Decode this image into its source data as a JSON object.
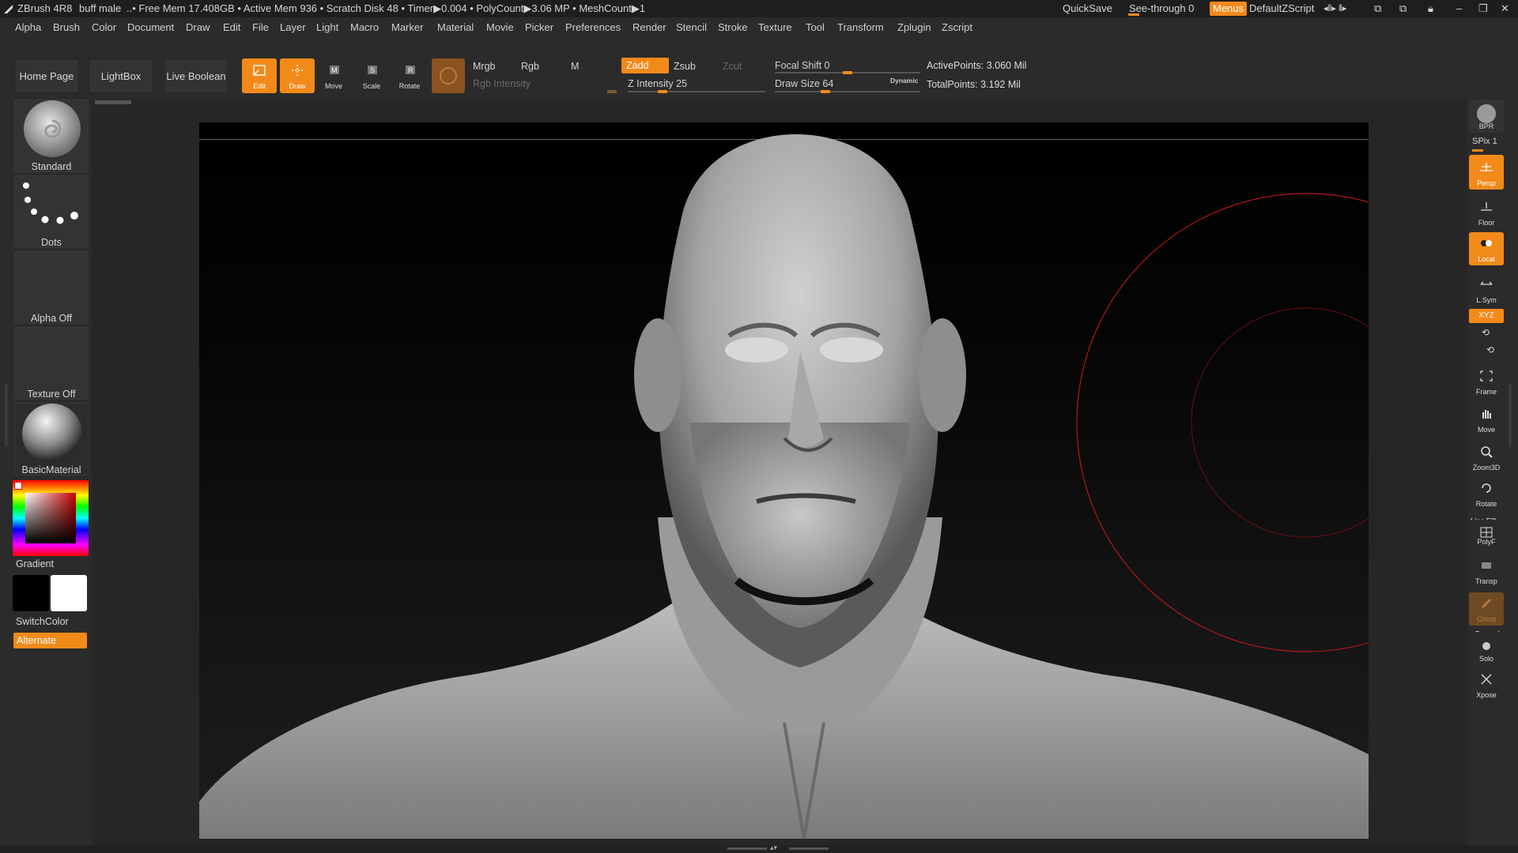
{
  "titlebar": {
    "app": "ZBrush 4R8",
    "doc": "buff male",
    "stats": "..• Free Mem 17.408GB • Active Mem 936 • Scratch Disk 48 •  Timer▶0.004 • PolyCount▶3.06 MP  • MeshCount▶1",
    "quicksave": "QuickSave",
    "seethrough": "See-through  0",
    "menus": "Menus",
    "script": "DefaultZScript"
  },
  "menu": [
    "Alpha",
    "Brush",
    "Color",
    "Document",
    "Draw",
    "Edit",
    "File",
    "Layer",
    "Light",
    "Macro",
    "Marker",
    "Material",
    "Movie",
    "Picker",
    "Preferences",
    "Render",
    "Stencil",
    "Stroke",
    "Texture",
    "Tool",
    "Transform",
    "Zplugin",
    "Zscript"
  ],
  "toolbar": {
    "home": "Home Page",
    "lightbox": "LightBox",
    "liveboolean": "Live Boolean",
    "tools": [
      {
        "label": "Edit",
        "active": true
      },
      {
        "label": "Draw",
        "active": true
      },
      {
        "label": "Move",
        "active": false
      },
      {
        "label": "Scale",
        "active": false
      },
      {
        "label": "Rotate",
        "active": false
      }
    ],
    "mrgb": "Mrgb",
    "rgb": "Rgb",
    "m": "M",
    "rgb_intensity": "Rgb Intensity",
    "zadd": "Zadd",
    "zsub": "Zsub",
    "zcut": "Zcut",
    "z_intensity": "Z Intensity 25",
    "focal_shift": "Focal Shift 0",
    "draw_size": "Draw Size 64",
    "dynamic": "Dynamic",
    "active_points": "ActivePoints: 3.060 Mil",
    "total_points": "TotalPoints: 3.192 Mil",
    "z_intensity_value": 25,
    "focal_shift_value": 0,
    "draw_size_value": 64
  },
  "leftshelf": {
    "brush": "Standard",
    "stroke": "Dots",
    "alpha": "Alpha Off",
    "texture": "Texture Off",
    "material": "BasicMaterial",
    "gradient": "Gradient",
    "switchcolor": "SwitchColor",
    "alternate": "Alternate"
  },
  "rightshelf": {
    "bpr": "BPR",
    "spix": "SPix 1",
    "buttons": [
      {
        "label": "Persp",
        "active": true
      },
      {
        "label": "Floor",
        "active": false
      },
      {
        "label": "Local",
        "active": true
      },
      {
        "label": "L.Sym",
        "active": false
      },
      {
        "label": "Frame",
        "active": false
      },
      {
        "label": "Move",
        "active": false
      },
      {
        "label": "Zoom3D",
        "active": false
      },
      {
        "label": "Rotate",
        "active": false
      },
      {
        "label": "PolyF",
        "active": false
      },
      {
        "label": "Transp",
        "active": false
      },
      {
        "label": "Ghost",
        "active": false
      },
      {
        "label": "Solo",
        "active": false
      },
      {
        "label": "Xpose",
        "active": false
      }
    ],
    "xyz": "XYZ",
    "linefill": "Line Fill",
    "dynamic": "Dynamic"
  },
  "colors": {
    "accent": "#f28a1a",
    "panel": "#2b2b2b",
    "brush_circle": "#b01818"
  }
}
